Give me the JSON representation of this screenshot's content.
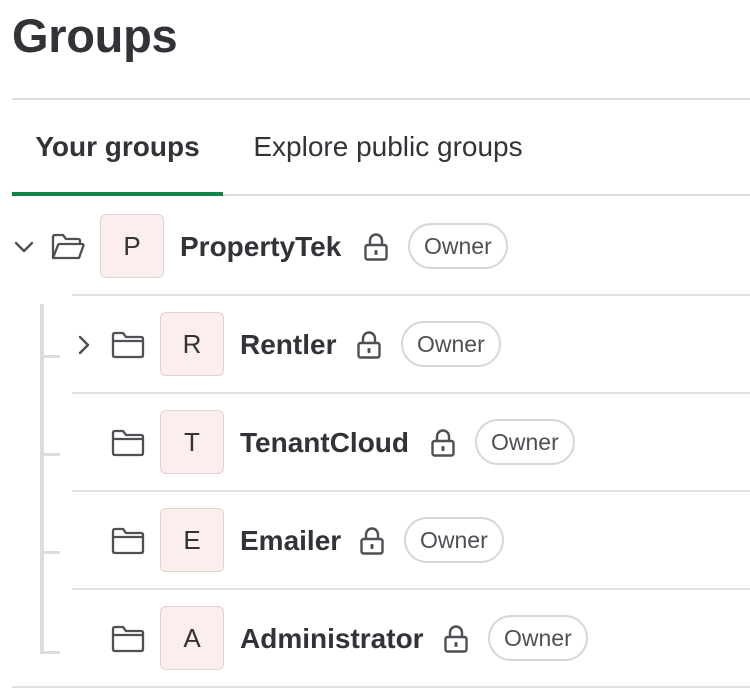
{
  "page": {
    "title": "Groups"
  },
  "tabs": [
    {
      "label": "Your groups",
      "active": true
    },
    {
      "label": "Explore public groups",
      "active": false
    }
  ],
  "groups": [
    {
      "avatar_letter": "P",
      "name": "PropertyTek",
      "role": "Owner",
      "visibility": "private",
      "expanded": true,
      "level": 0,
      "has_children": true
    },
    {
      "avatar_letter": "R",
      "name": "Rentler",
      "role": "Owner",
      "visibility": "private",
      "expanded": false,
      "level": 1,
      "has_children": true
    },
    {
      "avatar_letter": "T",
      "name": "TenantCloud",
      "role": "Owner",
      "visibility": "private",
      "level": 1,
      "has_children": false
    },
    {
      "avatar_letter": "E",
      "name": "Emailer",
      "role": "Owner",
      "visibility": "private",
      "level": 1,
      "has_children": false
    },
    {
      "avatar_letter": "A",
      "name": "Administrator",
      "role": "Owner",
      "visibility": "private",
      "level": 1,
      "has_children": false
    }
  ],
  "colors": {
    "active_tab_underline": "#108548",
    "avatar_background": "#fbeeec",
    "text": "#333238",
    "divider": "#dcdcde"
  },
  "icons": {
    "expand_open": "chevron-down-icon",
    "expand_closed": "chevron-right-icon",
    "folder_open": "folder-open-icon",
    "folder": "folder-icon",
    "visibility": "lock-icon"
  }
}
